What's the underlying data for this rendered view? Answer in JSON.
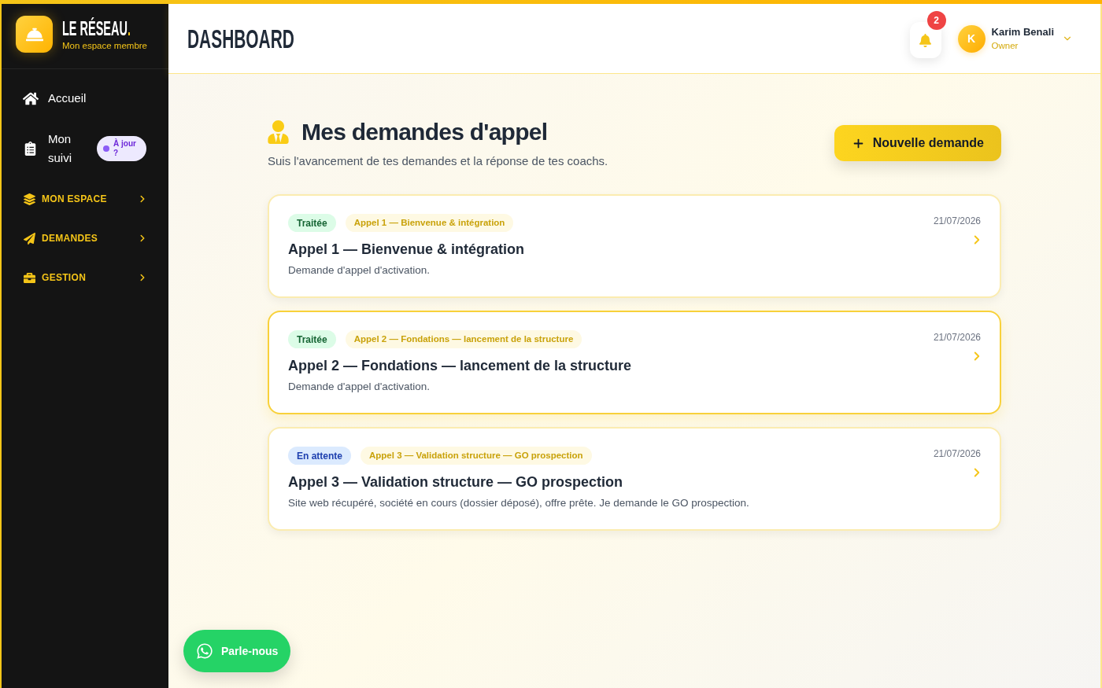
{
  "sidebar": {
    "brand": {
      "title": "LE RÉSEAU",
      "title_mark": ".",
      "subtitle": "Mon espace membre"
    },
    "items": [
      {
        "kind": "link",
        "label": "Accueil"
      },
      {
        "kind": "link",
        "label": "Mon suivi",
        "badge": "À jour ?"
      },
      {
        "kind": "group",
        "label": "MON ESPACE",
        "expanded": false
      },
      {
        "kind": "group",
        "label": "DEMANDES",
        "expanded": false
      },
      {
        "kind": "group",
        "label": "GESTION",
        "expanded": false
      }
    ]
  },
  "header": {
    "title": "DASHBOARD",
    "notifications": {
      "count": "2"
    },
    "user": {
      "initial": "K",
      "name": "Karim Benali",
      "role": "Owner"
    }
  },
  "page": {
    "title": "Mes demandes d'appel",
    "subtitle": "Suis l'avancement de tes demandes et la réponse de tes coachs.",
    "new_button": "Nouvelle demande"
  },
  "requests": [
    {
      "status": {
        "label": "Traitée",
        "kind": "done"
      },
      "tag": "Appel 1 — Bienvenue & intégration",
      "title": "Appel 1 — Bienvenue & intégration",
      "description": "Demande d'appel d'activation.",
      "date": "21/07/2026",
      "selected": false
    },
    {
      "status": {
        "label": "Traitée",
        "kind": "done"
      },
      "tag": "Appel 2 — Fondations — lancement de la structure",
      "title": "Appel 2 — Fondations — lancement de la structure",
      "description": "Demande d'appel d'activation.",
      "date": "21/07/2026",
      "selected": true
    },
    {
      "status": {
        "label": "En attente",
        "kind": "pending"
      },
      "tag": "Appel 3 — Validation structure — GO prospection",
      "title": "Appel 3 — Validation structure — GO prospection",
      "description": "Site web récupéré, société en cours (dossier déposé), offre prête. Je demande le GO prospection.",
      "date": "21/07/2026",
      "selected": false
    }
  ],
  "chat_button": "Parle-nous"
}
